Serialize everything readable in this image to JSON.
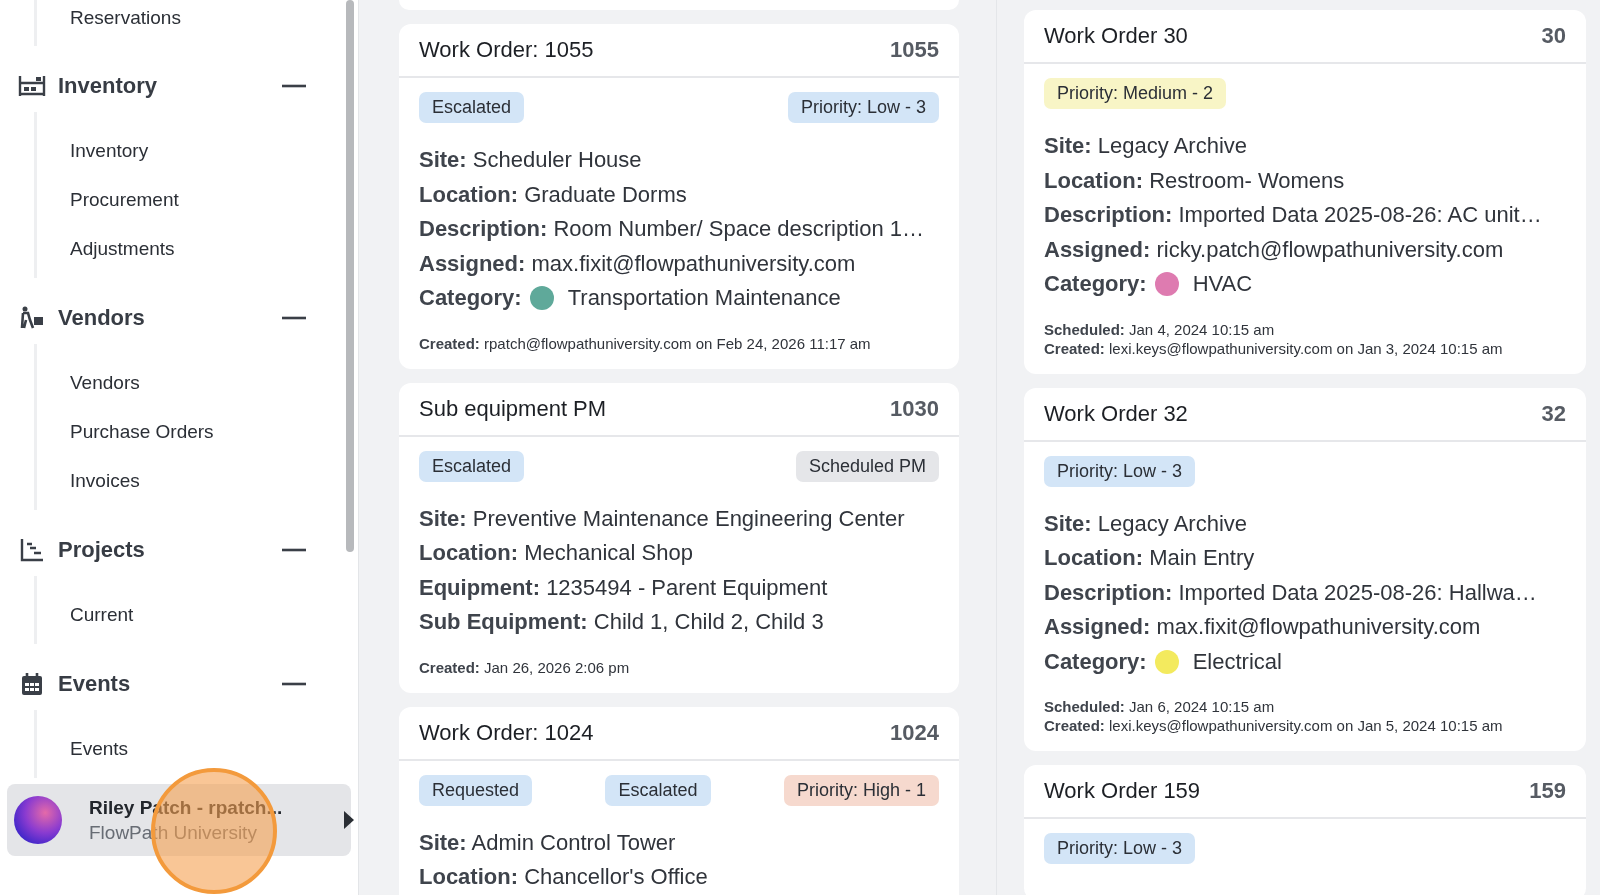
{
  "sidebar": {
    "top_items": [
      {
        "label": "Reservations"
      }
    ],
    "groups": [
      {
        "label": "Inventory",
        "expanded": true,
        "items": [
          {
            "label": "Inventory"
          },
          {
            "label": "Procurement"
          },
          {
            "label": "Adjustments"
          }
        ]
      },
      {
        "label": "Vendors",
        "expanded": true,
        "items": [
          {
            "label": "Vendors"
          },
          {
            "label": "Purchase Orders"
          },
          {
            "label": "Invoices"
          }
        ]
      },
      {
        "label": "Projects",
        "expanded": true,
        "items": [
          {
            "label": "Current"
          }
        ]
      },
      {
        "label": "Events",
        "expanded": true,
        "items": [
          {
            "label": "Events"
          }
        ]
      }
    ],
    "user": {
      "name": "Riley Patch - rpatch...",
      "org": "FlowPath University"
    }
  },
  "columns": [
    {
      "cards": [
        {
          "kind": "stub"
        },
        {
          "kind": "card",
          "title": "Work Order: 1055",
          "number": "1055",
          "tags": [
            {
              "label": "Escalated",
              "color": "#d3e5f7"
            },
            {
              "label": "Priority: Low - 3",
              "color": "#d3e5f7"
            }
          ],
          "fields": [
            {
              "label": "Site:",
              "value": "Scheduler House"
            },
            {
              "label": "Location:",
              "value": "Graduate Dorms"
            },
            {
              "label": "Description:",
              "value": "Room Number/ Space description 1…"
            },
            {
              "label": "Assigned:",
              "value": "max.fixit@flowpathuniversity.com"
            },
            {
              "label": "Category:",
              "value": "Transportation Maintenance",
              "color": "#5fa99a"
            }
          ],
          "footer": [
            {
              "label": "Created:",
              "value": "rpatch@flowpathuniversity.com on Feb 24, 2026 11:17 am"
            }
          ]
        },
        {
          "kind": "card",
          "title": "Sub equipment PM",
          "number": "1030",
          "tags": [
            {
              "label": "Escalated",
              "color": "#d3e5f7"
            },
            {
              "label": "Scheduled PM",
              "color": "#e5e6e9"
            }
          ],
          "fields": [
            {
              "label": "Site:",
              "value": "Preventive Maintenance Engineering Center"
            },
            {
              "label": "Location:",
              "value": "Mechanical Shop"
            },
            {
              "label": "Equipment:",
              "value": "1235494 - Parent Equipment"
            },
            {
              "label": "Sub Equipment:",
              "value": "Child 1, Child 2, Child 3"
            }
          ],
          "footer": [
            {
              "label": "Created:",
              "value": "Jan 26, 2026 2:06 pm"
            }
          ]
        },
        {
          "kind": "card",
          "title": "Work Order: 1024",
          "number": "1024",
          "tags": [
            {
              "label": "Requested",
              "color": "#d3e5f7"
            },
            {
              "label": "Escalated",
              "color": "#d3e5f7"
            },
            {
              "label": "Priority: High - 1",
              "color": "#f6d9ce"
            }
          ],
          "fields": [
            {
              "label": "Site:",
              "value": "Admin Control Tower"
            },
            {
              "label": "Location:",
              "value": "Chancellor's Office"
            }
          ]
        }
      ]
    },
    {
      "cards": [
        {
          "kind": "card",
          "title": "Work Order 30",
          "number": "30",
          "tags": [
            {
              "label": "Priority: Medium - 2",
              "color": "#f8f5c6"
            }
          ],
          "fields": [
            {
              "label": "Site:",
              "value": "Legacy Archive"
            },
            {
              "label": "Location:",
              "value": "Restroom- Womens"
            },
            {
              "label": "Description:",
              "value": "Imported Data 2025-08-26: AC unit…"
            },
            {
              "label": "Assigned:",
              "value": "ricky.patch@flowpathuniversity.com"
            },
            {
              "label": "Category:",
              "value": "HVAC",
              "color": "#de7bb0"
            }
          ],
          "footer": [
            {
              "label": "Scheduled:",
              "value": "Jan 4, 2024 10:15 am"
            },
            {
              "label": "Created:",
              "value": "lexi.keys@flowpathuniversity.com on Jan 3, 2024 10:15 am"
            }
          ]
        },
        {
          "kind": "card",
          "title": "Work Order 32",
          "number": "32",
          "tags": [
            {
              "label": "Priority: Low - 3",
              "color": "#d3e5f7"
            }
          ],
          "fields": [
            {
              "label": "Site:",
              "value": "Legacy Archive"
            },
            {
              "label": "Location:",
              "value": "Main Entry"
            },
            {
              "label": "Description:",
              "value": "Imported Data 2025-08-26: Hallwa…"
            },
            {
              "label": "Assigned:",
              "value": "max.fixit@flowpathuniversity.com"
            },
            {
              "label": "Category:",
              "value": "Electrical",
              "color": "#f3ea5e"
            }
          ],
          "footer": [
            {
              "label": "Scheduled:",
              "value": "Jan 6, 2024 10:15 am"
            },
            {
              "label": "Created:",
              "value": "lexi.keys@flowpathuniversity.com on Jan 5, 2024 10:15 am"
            }
          ]
        },
        {
          "kind": "card",
          "title": "Work Order 159",
          "number": "159",
          "tags": [
            {
              "label": "Priority: Low - 3",
              "color": "#d3e5f7"
            }
          ]
        }
      ]
    }
  ]
}
